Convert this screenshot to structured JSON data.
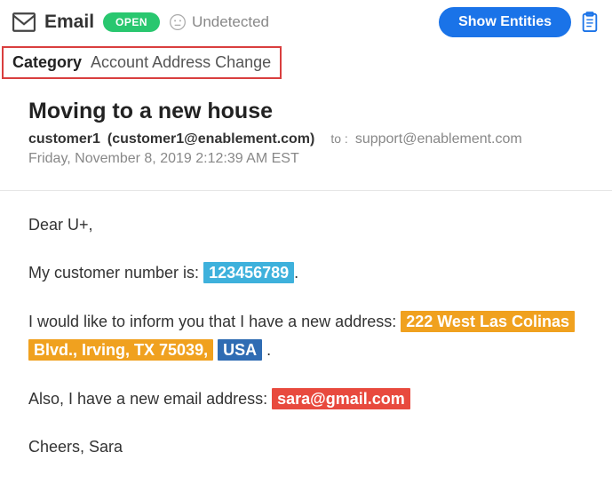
{
  "header": {
    "type_label": "Email",
    "status_badge": "OPEN",
    "sentiment_label": "Undetected",
    "show_entities_label": "Show Entities"
  },
  "category": {
    "label": "Category",
    "value": "Account Address Change"
  },
  "email": {
    "subject": "Moving to a new house",
    "from_name": "customer1",
    "from_email": "(customer1@enablement.com)",
    "to_label": "to :",
    "to_email": "support@enablement.com",
    "date": "Friday, November 8, 2019 2:12:39 AM EST"
  },
  "body": {
    "greeting": "Dear U+,",
    "line1_prefix": "My customer number is: ",
    "customer_number": "123456789",
    "period": ".",
    "line2_prefix": "I would like to inform you that I have a new address: ",
    "address_part1": "222 West Las Colinas",
    "address_part2": "Blvd., Irving, TX 75039,",
    "address_part3": "USA",
    "line3_prefix": "Also, I have a new email address: ",
    "new_email": "sara@gmail.com",
    "closing": "Cheers, Sara"
  },
  "entities": {
    "customer_number_color": "#3eb1dc",
    "address_color": "#f0a11f",
    "country_color": "#2f6cb3",
    "email_color": "#e84a3e"
  }
}
